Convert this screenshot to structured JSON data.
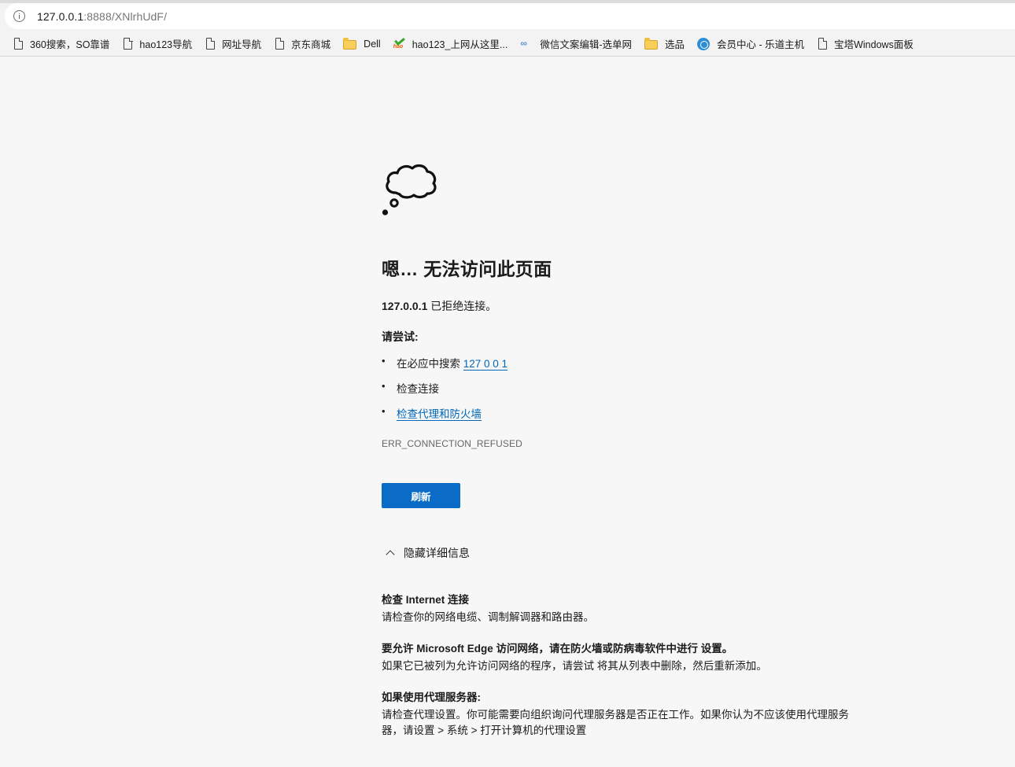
{
  "address_bar": {
    "url_host": "127.0.0.1",
    "url_rest": ":8888/XNlrhUdF/"
  },
  "bookmarks": [
    {
      "label": "360搜索，SO靠谱",
      "icon": "page-icon"
    },
    {
      "label": "hao123导航",
      "icon": "page-icon"
    },
    {
      "label": "网址导航",
      "icon": "page-icon"
    },
    {
      "label": "京东商城",
      "icon": "page-icon"
    },
    {
      "label": "Dell",
      "icon": "folder-icon"
    },
    {
      "label": "hao123_上网从这里...",
      "icon": "hao123-icon"
    },
    {
      "label": "微信文案编辑-选单网",
      "icon": "xuandan-icon"
    },
    {
      "label": "选品",
      "icon": "folder-icon"
    },
    {
      "label": "会员中心 - 乐道主机",
      "icon": "ledao-icon"
    },
    {
      "label": "宝塔Windows面板",
      "icon": "page-icon"
    }
  ],
  "error_page": {
    "icon": "thought-cloud-icon",
    "title": "嗯… 无法访问此页面",
    "host": "127.0.0.1",
    "message": "已拒绝连接。",
    "try_label": "请尝试:",
    "suggestions": {
      "search_prefix": "在必应中搜索",
      "search_link": "127 0 0 1",
      "check_connection": "检查连接",
      "check_proxy_link": "检查代理和防火墙"
    },
    "error_code": "ERR_CONNECTION_REFUSED",
    "refresh_label": "刷新",
    "hide_details_label": "隐藏详细信息",
    "details": {
      "internet_head": "检查 Internet 连接",
      "internet_body": "请检查你的网络电缆、调制解调器和路由器。",
      "firewall_head": "要允许 Microsoft Edge 访问网络，请在防火墙或防病毒软件中进行 设置。",
      "firewall_body": "如果它已被列为允许访问网络的程序，请尝试 将其从列表中删除，然后重新添加。",
      "proxy_head": "如果使用代理服务器:",
      "proxy_body": "请检查代理设置。你可能需要向组织询问代理服务器是否正在工作。如果你认为不应该使用代理服务器，请设置 > 系统 > 打开计算机的代理设置"
    }
  },
  "colors": {
    "accent": "#0a6cc7",
    "link": "#0067b8",
    "page_bg": "#f7f7f7"
  }
}
